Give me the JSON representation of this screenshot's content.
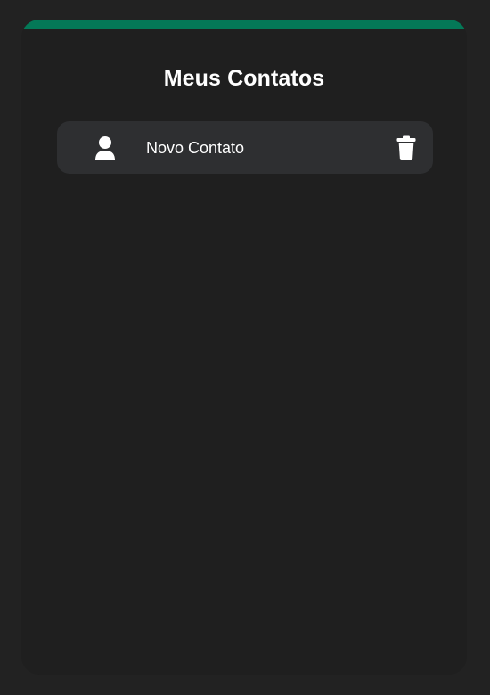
{
  "page": {
    "title": "Meus Contatos"
  },
  "colors": {
    "background": "#222222",
    "card": "#1f1f1f",
    "accent": "#047857",
    "item": "#2e2f31",
    "text": "#ffffff"
  },
  "contacts": [
    {
      "name": "Novo Contato",
      "avatar_icon": "user-icon",
      "action_icon": "trash-icon"
    }
  ]
}
